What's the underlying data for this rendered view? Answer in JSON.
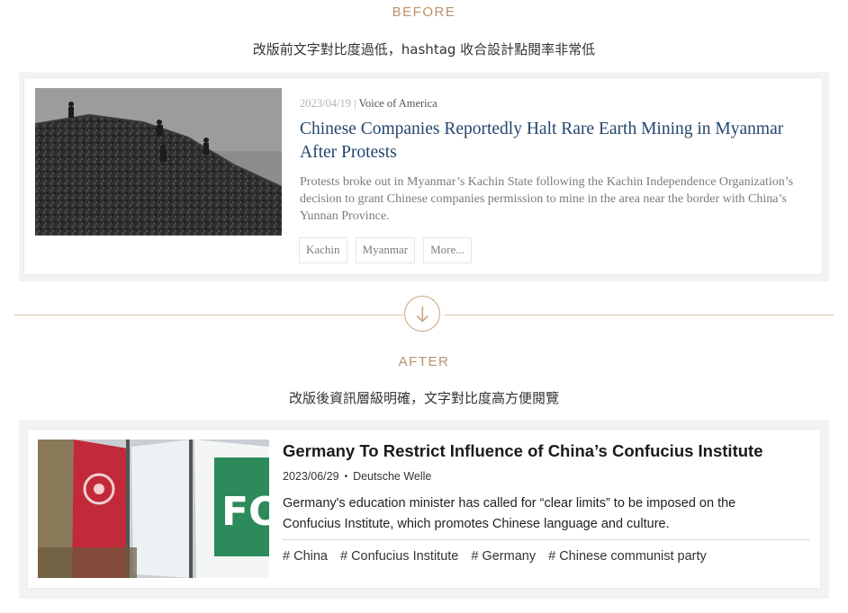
{
  "before": {
    "label": "BEFORE",
    "caption": "改版前文字對比度過低，hashtag 收合設計點閱率非常低",
    "article": {
      "date": "2023/04/19",
      "separator": " | ",
      "source": "Voice of America",
      "title": "Chinese Companies Reportedly Halt Rare Earth Mining in Myanmar After Protests",
      "description": "Protests broke out in Myanmar’s Kachin State following the Kachin Independence Organization’s decision to grant Chinese companies permission to mine in the area near the border with China’s Yunnan Province.",
      "tags": [
        "Kachin",
        "Myanmar",
        "More..."
      ]
    }
  },
  "divider": {
    "icon": "arrow-down-circle-icon",
    "color": "#c9a67e"
  },
  "after": {
    "label": "AFTER",
    "caption": "改版後資訊層級明確，文字對比度高方便閱覽",
    "article": {
      "title": "Germany To Restrict Influence of China’s Confucius Institute",
      "date": "2023/06/29",
      "dot": "•",
      "source": "Deutsche Welle",
      "description": "Germany's education minister has called for “clear limits” to be imposed on the Confucius Institute, which promotes Chinese language and culture.",
      "tags": [
        "# China",
        "# Confucius Institute",
        "# Germany",
        "# Chinese communist party"
      ]
    }
  },
  "colors": {
    "accent": "#b9926a",
    "before_title": "#24466e",
    "before_muted": "#7b7b7b",
    "after_text": "#1a1a1a"
  }
}
